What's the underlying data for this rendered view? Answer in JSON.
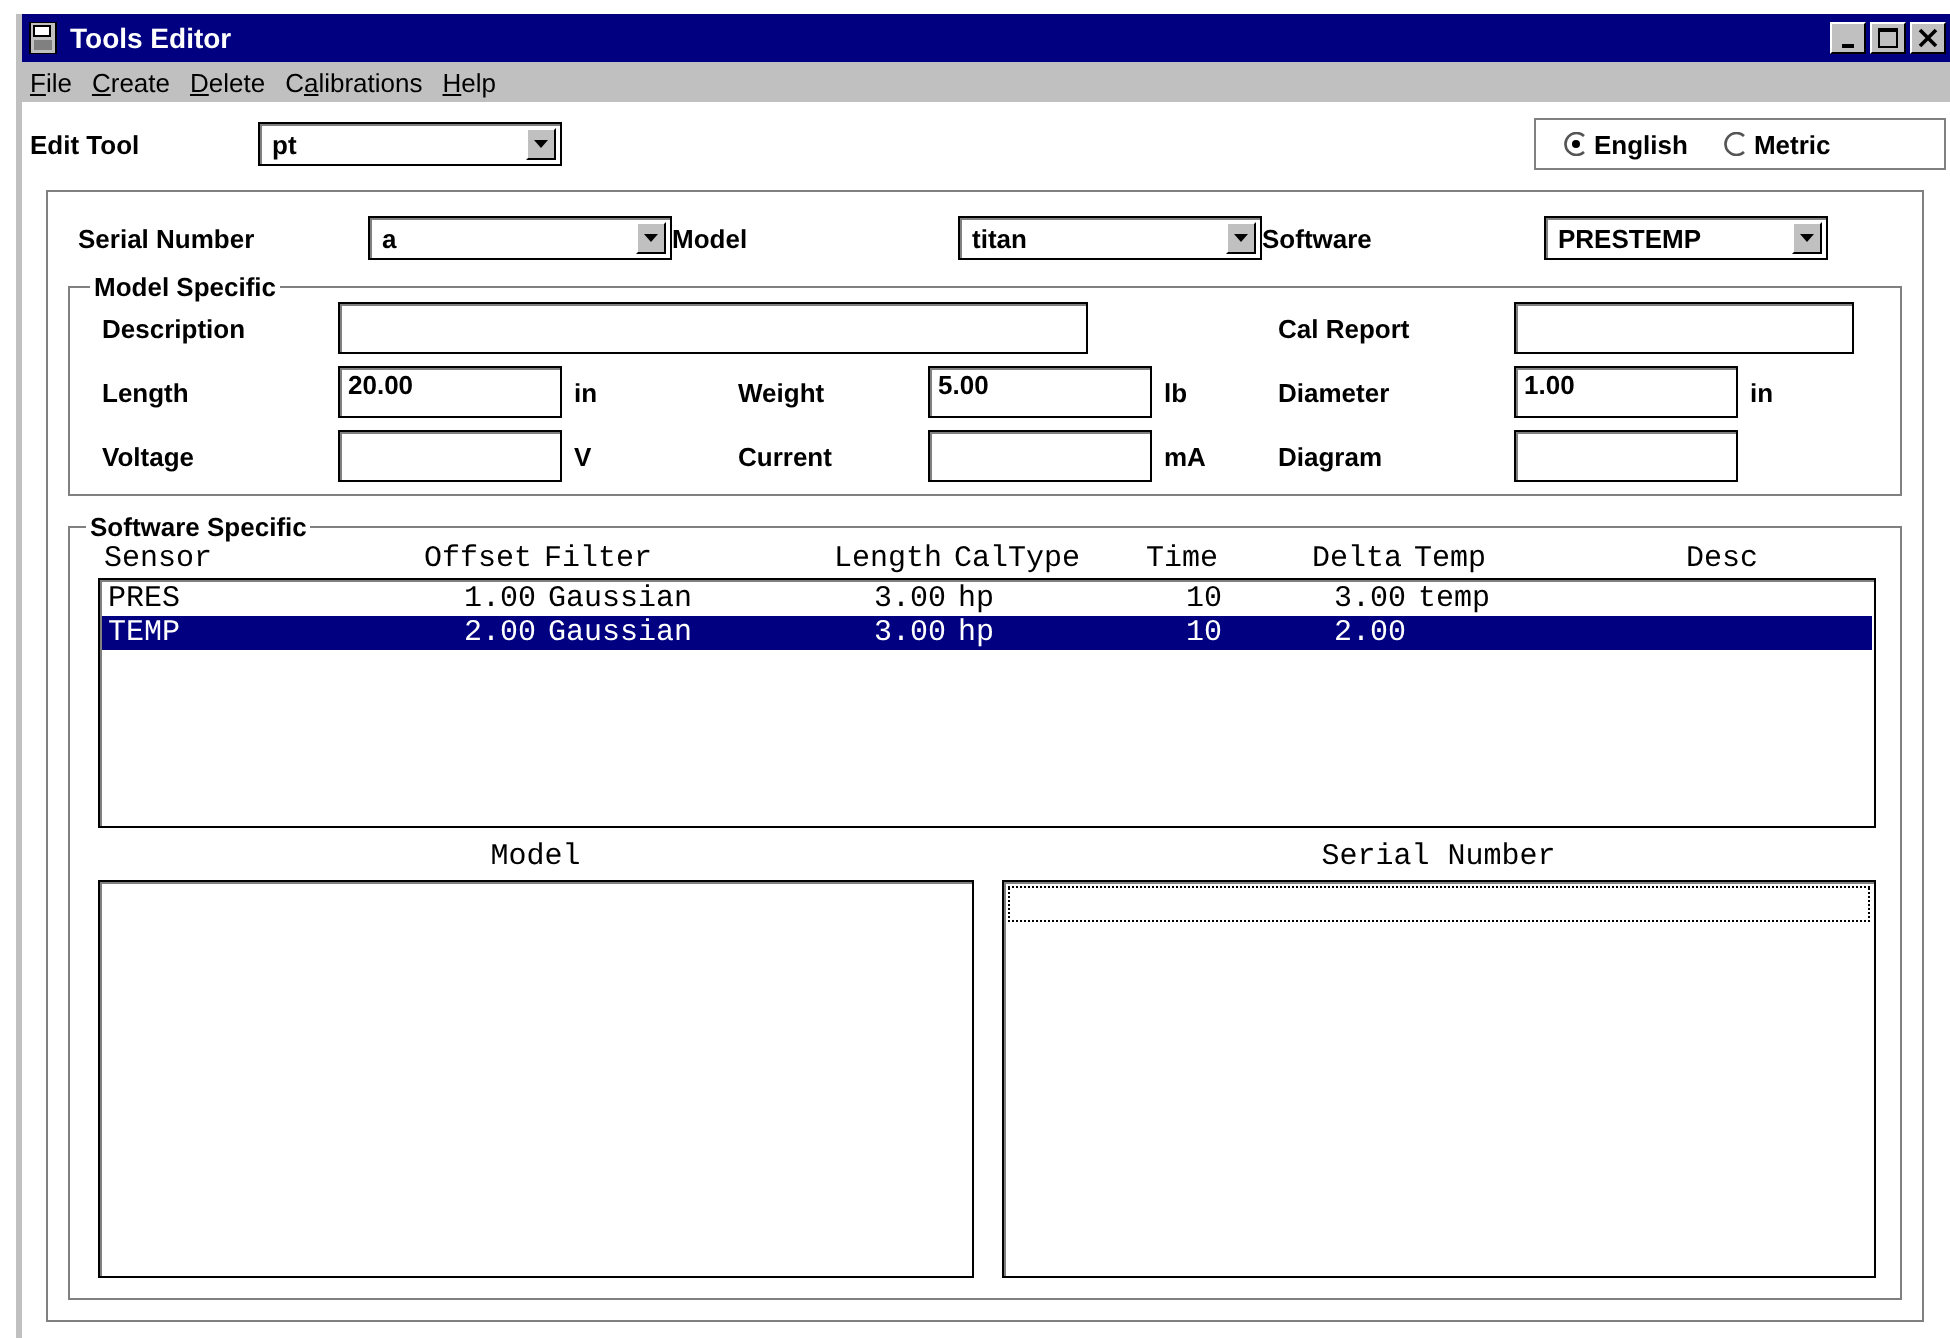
{
  "window": {
    "title": "Tools Editor"
  },
  "menu": [
    {
      "label": "File"
    },
    {
      "label": "Create"
    },
    {
      "label": "Delete"
    },
    {
      "label": "Calibrations"
    },
    {
      "label": "Help"
    }
  ],
  "edit_tool": {
    "label": "Edit Tool",
    "value": "pt"
  },
  "units": [
    {
      "label": "English",
      "selected": true
    },
    {
      "label": "Metric",
      "selected": false
    }
  ],
  "top_fields": [
    {
      "label": "Serial Number",
      "value": "a"
    },
    {
      "label": "Model",
      "value": "titan"
    },
    {
      "label": "Software",
      "value": "PRESTEMP"
    }
  ],
  "model_specific": {
    "title": "Model Specific",
    "description": {
      "label": "Description"
    },
    "cal_report": {
      "label": "Cal Report"
    },
    "rows": [
      [
        {
          "label": "Length",
          "value": "20.00",
          "unit": "in"
        },
        {
          "label": "Weight",
          "value": "5.00",
          "unit": "lb"
        },
        {
          "label": "Diameter",
          "value": "1.00",
          "unit": "in"
        }
      ],
      [
        {
          "label": "Voltage",
          "unit": "V"
        },
        {
          "label": "Current",
          "unit": "mA"
        },
        {
          "label": "Diagram"
        }
      ]
    ]
  },
  "software_specific": {
    "title": "Software Specific",
    "columns": [
      "Sensor",
      "Offset",
      "Filter",
      "Length",
      "CalType",
      "Time",
      "Delta",
      "Temp",
      "Desc"
    ],
    "rows": [
      {
        "cells": [
          "PRES",
          "1.00",
          "Gaussian",
          "3.00",
          "hp",
          "10",
          "3.00",
          "temp",
          ""
        ],
        "selected": false
      },
      {
        "cells": [
          "TEMP",
          "2.00",
          "Gaussian",
          "3.00",
          "hp",
          "10",
          "2.00",
          "",
          ""
        ],
        "selected": true
      }
    ]
  },
  "model_list": {
    "label": "Model"
  },
  "serial_list": {
    "label": "Serial Number",
    "focused": true
  }
}
